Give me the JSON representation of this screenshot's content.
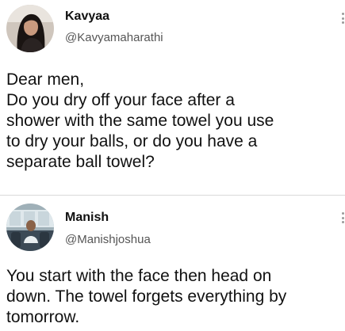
{
  "tweets": [
    {
      "author": {
        "name": "Kavyaa",
        "handle": "@Kavyamaharathi",
        "avatar_icon": "profile-photo-woman"
      },
      "more_icon": "vertical-ellipsis",
      "lines": [
        "Dear men,",
        "Do you dry off your face after a",
        "shower with the same towel you use",
        "to dry your balls, or do you have a",
        "separate ball towel?"
      ]
    },
    {
      "author": {
        "name": "Manish",
        "handle": "@Manishjoshua",
        "avatar_icon": "profile-photo-man-in-bus"
      },
      "more_icon": "vertical-ellipsis",
      "lines": [
        "You start with the face then head on",
        "down. The towel forgets everything by",
        "tomorrow."
      ]
    }
  ],
  "colors": {
    "text": "#111111",
    "handle": "#555555",
    "divider": "#d9d9d9",
    "more_dots": "#9a9a9a"
  }
}
